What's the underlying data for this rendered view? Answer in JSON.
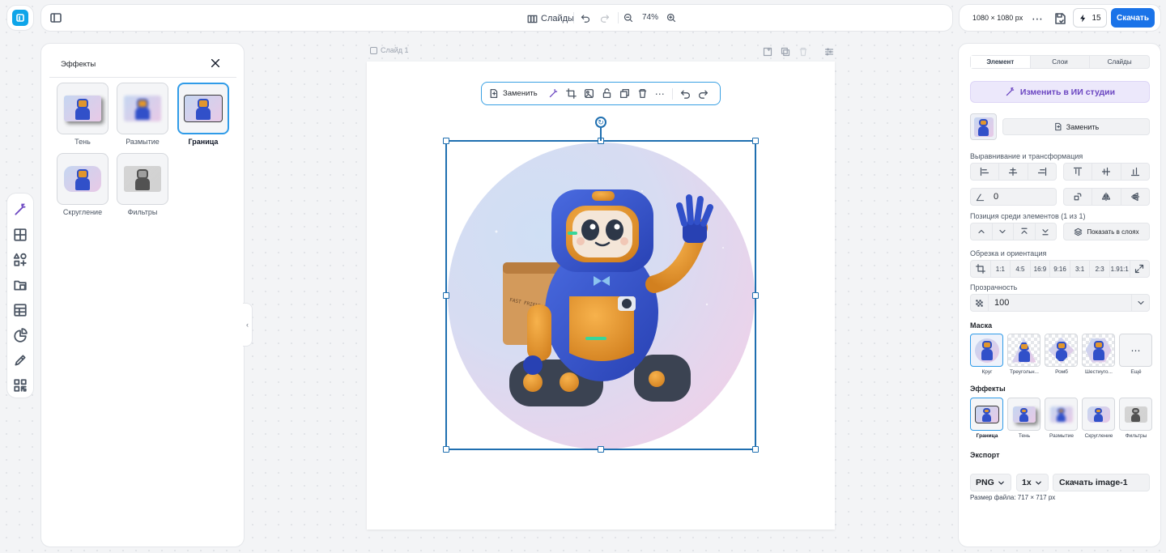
{
  "colors": {
    "accent": "#1a73e8",
    "selection": "#1f6fb0",
    "ai_purple": "#6b46c1",
    "logo": "#0ea5e9"
  },
  "topbar": {
    "slides_label": "Слайды",
    "zoom": "74%",
    "size_label": "1080 × 1080 px",
    "credits": "15",
    "download_label": "Скачать"
  },
  "effects_panel": {
    "title": "Эффекты",
    "items": [
      {
        "label": "Тень",
        "selected": false
      },
      {
        "label": "Размытие",
        "selected": false
      },
      {
        "label": "Граница",
        "selected": true
      },
      {
        "label": "Скругление",
        "selected": false
      },
      {
        "label": "Фильтры",
        "selected": false
      }
    ]
  },
  "canvas": {
    "slide_label": "Слайд 1",
    "replace_label": "Заменить"
  },
  "image_text": {
    "box_text": "FAST FRIENDLY DELIVERY"
  },
  "right_panel": {
    "tabs": [
      "Элемент",
      "Слои",
      "Слайды"
    ],
    "ai_button": "Изменить в ИИ студии",
    "replace_button": "Заменить",
    "align_label": "Выравнивание и трансформация",
    "rotation_value": "0",
    "position_label": "Позиция среди элементов (1 из 1)",
    "show_layers": "Показать в слоях",
    "crop_label": "Обрезка и ориентация",
    "crop_ratios": [
      "1:1",
      "4:5",
      "16:9",
      "9:16",
      "3:1",
      "2:3",
      "1.91:1"
    ],
    "opacity_label": "Прозрачность",
    "opacity_value": "100",
    "mask_label": "Маска",
    "masks": [
      "Круг",
      "Треугольн...",
      "Ромб",
      "Шестиуго...",
      "Ещё"
    ],
    "effects_label": "Эффекты",
    "effects": [
      "Граница",
      "Тень",
      "Размытие",
      "Скругление",
      "Фильтры"
    ],
    "export_label": "Экспорт",
    "export_format": "PNG",
    "export_scale": "1x",
    "export_button": "Скачать image-1",
    "file_size": "Размер файла: 717 × 717 px"
  }
}
